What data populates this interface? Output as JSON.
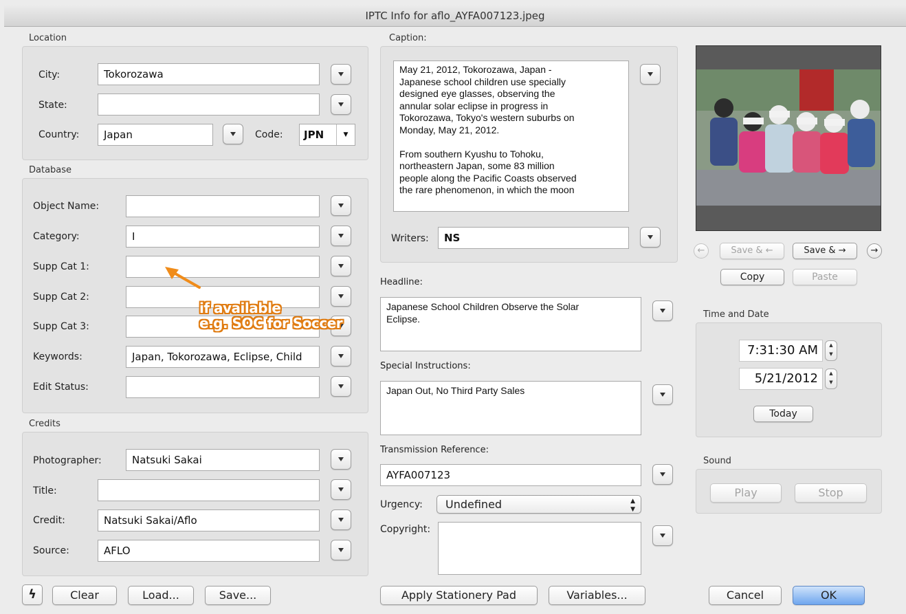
{
  "window": {
    "title": "IPTC Info for aflo_AYFA007123.jpeg"
  },
  "location": {
    "label": "Location",
    "city_label": "City:",
    "city_value": "Tokorozawa",
    "state_label": "State:",
    "state_value": "",
    "country_label": "Country:",
    "country_value": "Japan",
    "code_label": "Code:",
    "code_value": "JPN"
  },
  "database": {
    "label": "Database",
    "object_name_label": "Object Name:",
    "object_name_value": "",
    "category_label": "Category:",
    "category_value": "I",
    "supp1_label": "Supp Cat 1:",
    "supp1_value": "",
    "supp2_label": "Supp Cat 2:",
    "supp2_value": "",
    "supp3_label": "Supp Cat 3:",
    "supp3_value": "",
    "keywords_label": "Keywords:",
    "keywords_value": "Japan, Tokorozawa, Eclipse, Child",
    "edit_status_label": "Edit Status:",
    "edit_status_value": ""
  },
  "annotation": {
    "line1": "if available",
    "line2": "e.g. SOC for Soccer",
    "color": "#e07c12"
  },
  "credits": {
    "label": "Credits",
    "photographer_label": "Photographer:",
    "photographer_value": "Natsuki Sakai",
    "title_label": "Title:",
    "title_value": "",
    "credit_label": "Credit:",
    "credit_value": "Natsuki Sakai/Aflo",
    "source_label": "Source:",
    "source_value": "AFLO"
  },
  "caption": {
    "label": "Caption:",
    "text": "May 21, 2012, Tokorozawa, Japan -\nJapanese school children use specially\ndesigned eye glasses, observing the\nannular solar eclipse in progress in\nTokorozawa, Tokyo's western suburbs on\nMonday, May 21, 2012.\n\nFrom southern Kyushu to Tohoku,\nnortheastern Japan, some 83 million\npeople along the Pacific Coasts observed\nthe rare phenomenon, in which the moon",
    "writers_label": "Writers:",
    "writers_value": "NS"
  },
  "headline": {
    "label": "Headline:",
    "value": "Japanese School Children Observe the Solar\nEclipse."
  },
  "special_instructions": {
    "label": "Special Instructions:",
    "value": "Japan Out, No Third Party Sales"
  },
  "transmission": {
    "label": "Transmission Reference:",
    "value": "AYFA007123"
  },
  "urgency": {
    "label": "Urgency:",
    "value": "Undefined"
  },
  "copyright": {
    "label": "Copyright:",
    "value": ""
  },
  "preview": {
    "prev_icon": "←",
    "next_icon": "→",
    "save_prev": "Save & ←",
    "save_next": "Save & →",
    "copy": "Copy",
    "paste": "Paste"
  },
  "time_date": {
    "label": "Time and Date",
    "time": "7:31:30 AM",
    "date": "5/21/2012",
    "today": "Today"
  },
  "sound": {
    "label": "Sound",
    "play": "Play",
    "stop": "Stop"
  },
  "footer": {
    "lightning_icon": "ϟ",
    "clear": "Clear",
    "load": "Load...",
    "save": "Save...",
    "apply": "Apply Stationery Pad",
    "variables": "Variables...",
    "cancel": "Cancel",
    "ok": "OK"
  }
}
